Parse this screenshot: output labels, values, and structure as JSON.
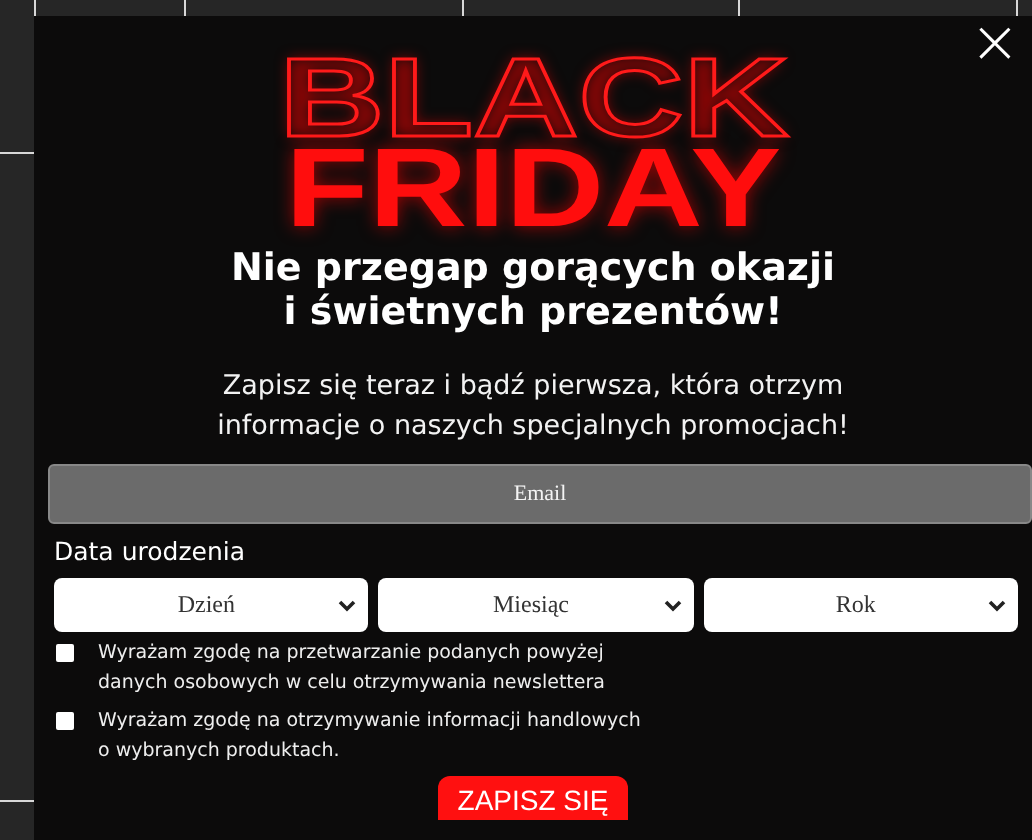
{
  "popup": {
    "close": "×",
    "brand_line_1": "BLACK",
    "brand_line_2": "FRIDAY",
    "heading": "Nie przegap gorących okazji\ni świetnych prezentów!",
    "description": "Zapisz się teraz i bądź pierwsza, która otrzym\ninformacje o naszych specjalnych promocjach!",
    "email": {
      "placeholder": "Email"
    },
    "birth_date": {
      "label": "Data urodzenia",
      "selects": [
        {
          "value": "Dzień"
        },
        {
          "value": "Miesiąc"
        },
        {
          "value": "Rok"
        }
      ]
    },
    "consents": [
      {
        "text": "Wyrażam zgodę na przetwarzanie podanych powyżej\ndanych osobowych w celu otrzymywania newslettera",
        "checked": false
      },
      {
        "text": "Wyrażam zgodę na otrzymywanie informacji handlowych\n o wybranych produktach.",
        "checked": false
      }
    ],
    "submit": "ZAPISZ SIĘ"
  }
}
